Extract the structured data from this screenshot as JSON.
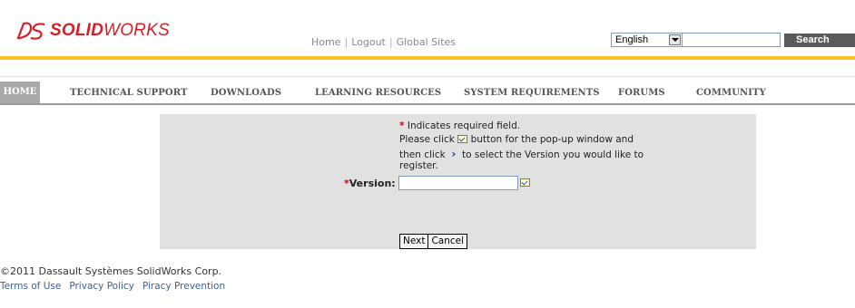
{
  "header": {
    "logo_mark": "3S",
    "logo_bold": "SOLID",
    "logo_light": "WORKS",
    "links": [
      "Home",
      "Logout",
      "Global Sites"
    ],
    "language_value": "English",
    "search_value": "",
    "search_button": "Search"
  },
  "nav": {
    "items": [
      "HOME",
      "TECHNICAL SUPPORT",
      "DOWNLOADS",
      "LEARNING RESOURCES",
      "SYSTEM REQUIREMENTS",
      "FORUMS",
      "COMMUNITY"
    ],
    "active": "HOME"
  },
  "form": {
    "required_star": "*",
    "required_note": "Indicates required field.",
    "instr_1a": "Please click",
    "instr_1b": "button for the pop-up window and",
    "instr_2a": "then click",
    "instr_2b": "to select the Version you would like to",
    "instr_3": "register.",
    "version_label": "Version:",
    "version_value": "",
    "next_button": "Next",
    "cancel_button": "Cancel"
  },
  "footer": {
    "copyright": "©2011 Dassault Systèmes SolidWorks Corp.",
    "links": [
      "Terms of Use",
      "Privacy Policy",
      "Piracy Prevention"
    ]
  },
  "colors": {
    "brand_red": "#d81f26",
    "accent_yellow": "#f6c229",
    "panel_gray": "#e1e1e1",
    "link_blue": "#3a5fa0"
  }
}
